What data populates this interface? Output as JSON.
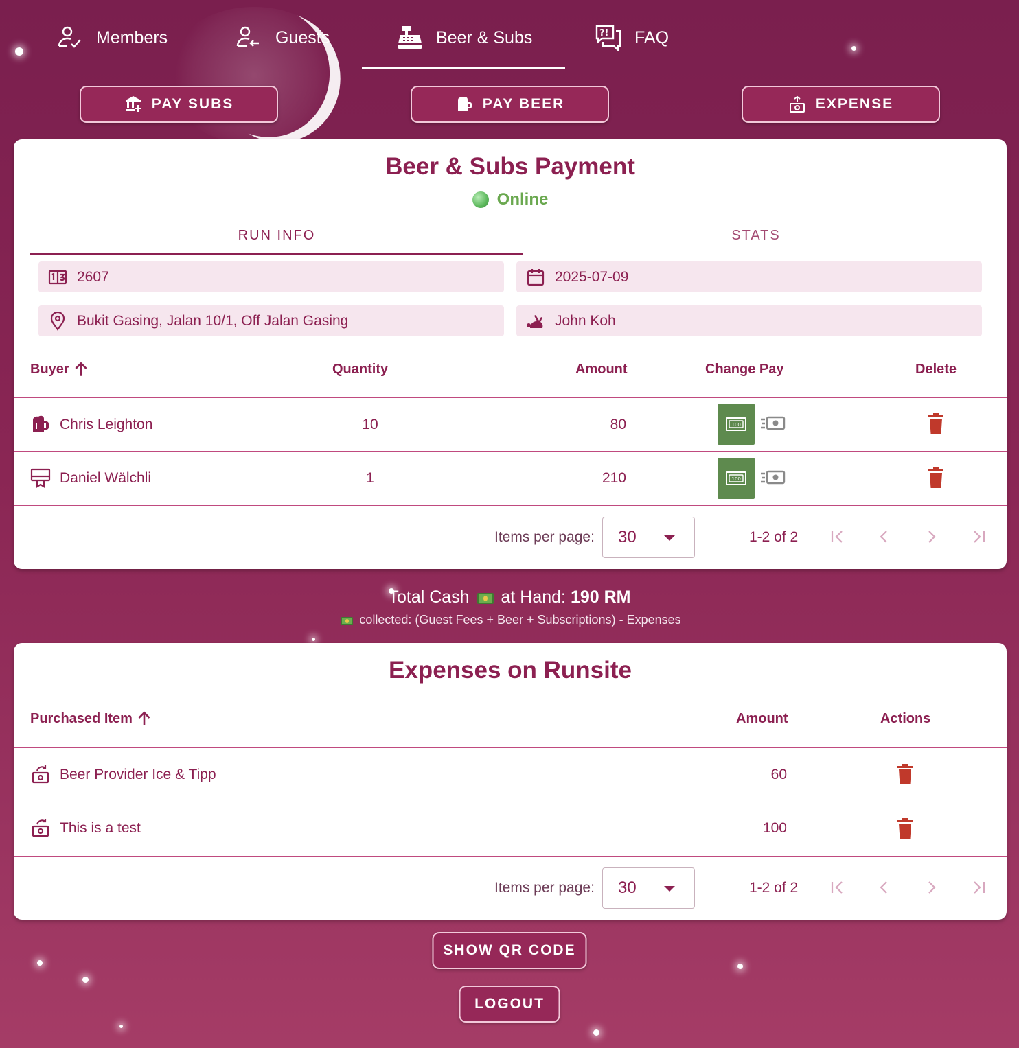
{
  "nav": {
    "tabs": [
      {
        "label": "Members",
        "icon": "member-check-icon"
      },
      {
        "label": "Guests",
        "icon": "guest-arrow-icon"
      },
      {
        "label": "Beer & Subs",
        "icon": "cash-register-icon",
        "active": true
      },
      {
        "label": "FAQ",
        "icon": "faq-icon"
      }
    ]
  },
  "actions": {
    "pay_subs": "PAY SUBS",
    "pay_beer": "PAY BEER",
    "expense": "EXPENSE"
  },
  "payment_card": {
    "title": "Beer & Subs Payment",
    "status": "Online",
    "status_color": "#6aa84f",
    "tabs": {
      "run_info": "RUN INFO",
      "stats": "STATS"
    },
    "run_number": "2607",
    "run_date": "2025-07-09",
    "location": "Bukit Gasing, Jalan 10/1, Off Jalan Gasing",
    "hare": "John Koh",
    "table": {
      "headers": {
        "buyer": "Buyer",
        "quantity": "Quantity",
        "amount": "Amount",
        "change_pay": "Change Pay",
        "delete": "Delete"
      },
      "rows": [
        {
          "buyer": "Chris Leighton",
          "icon": "beer-mug-icon",
          "quantity": "10",
          "amount": "80"
        },
        {
          "buyer": "Daniel Wälchli",
          "icon": "subscription-icon",
          "quantity": "1",
          "amount": "210"
        }
      ]
    },
    "pager": {
      "label": "Items per page:",
      "per_page": "30",
      "range": "1-2 of 2"
    }
  },
  "cash": {
    "prefix": "Total Cash",
    "middle": "at Hand:",
    "total": "190 RM",
    "note": "collected: (Guest Fees + Beer + Subscriptions) - Expenses"
  },
  "expenses_card": {
    "title": "Expenses on Runsite",
    "table": {
      "headers": {
        "item": "Purchased Item",
        "amount": "Amount",
        "actions": "Actions"
      },
      "rows": [
        {
          "item": "Beer Provider Ice & Tipp",
          "icon": "expense-icon",
          "amount": "60"
        },
        {
          "item": "This is a test",
          "icon": "expense-icon",
          "amount": "100"
        }
      ]
    },
    "pager": {
      "label": "Items per page:",
      "per_page": "30",
      "range": "1-2 of 2"
    }
  },
  "footer": {
    "show_qr": "SHOW QR CODE",
    "logout": "LOGOUT"
  },
  "colors": {
    "brand": "#8c2051",
    "background": "#7a1f4e",
    "delete": "#c0392b",
    "cash_button": "#5e8a4e"
  }
}
